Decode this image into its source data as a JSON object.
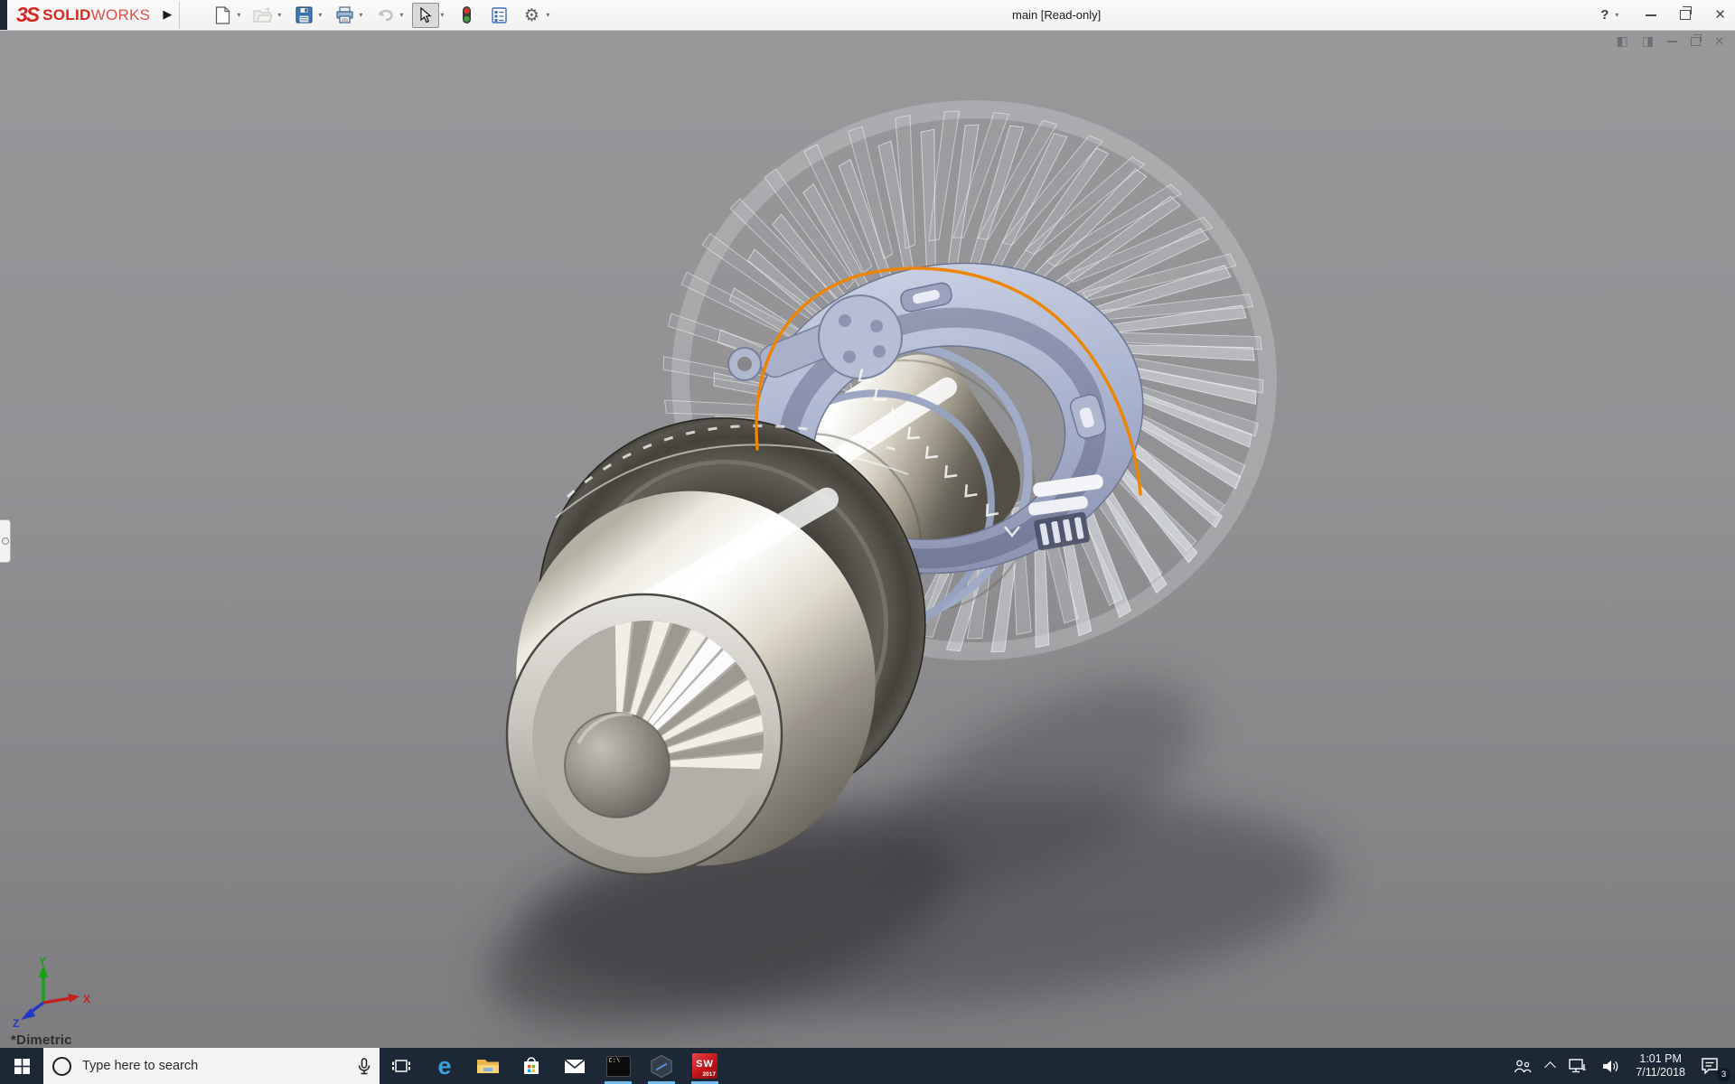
{
  "titlebar": {
    "brand": {
      "mark": "3S",
      "bold": "SOLID",
      "light": "WORKS"
    },
    "title": "main [Read-only]",
    "glyphs": {
      "flyout": "▶",
      "caret": "▾",
      "help": "?",
      "close": "✕"
    },
    "tools": [
      {
        "name": "new-document",
        "enabled": true
      },
      {
        "name": "open",
        "enabled": false
      },
      {
        "name": "save",
        "enabled": true
      },
      {
        "name": "print",
        "enabled": true
      },
      {
        "name": "undo",
        "enabled": false
      },
      {
        "name": "select",
        "enabled": true,
        "active": true
      },
      {
        "name": "rebuild",
        "enabled": true
      },
      {
        "name": "file-properties",
        "enabled": true
      },
      {
        "name": "options",
        "enabled": true
      }
    ]
  },
  "viewport": {
    "view_orientation_label": "*Dimetric",
    "triad": {
      "x_label": "X",
      "y_label": "Y",
      "z_label": "Z",
      "x_color": "#c42020",
      "y_color": "#18a018",
      "z_color": "#2438c8"
    },
    "selection_highlight_color": "#ee8500",
    "doc_controls_glyphs": {
      "pane_left": "◧",
      "pane_right": "◨",
      "close": "✕"
    },
    "background_top": "#98989b",
    "background_bottom": "#7d7d80"
  },
  "taskbar": {
    "search": {
      "placeholder": "Type here to search"
    },
    "app_glyphs": {
      "edge": "e",
      "command_prompt": "C:\\",
      "options_gear": "⚙"
    },
    "solidworks_icon": {
      "line1": "SW",
      "line2": "2017"
    },
    "apps": [
      {
        "name": "task-view",
        "running": false
      },
      {
        "name": "edge",
        "running": false
      },
      {
        "name": "file-explorer",
        "running": false
      },
      {
        "name": "store",
        "running": false
      },
      {
        "name": "mail",
        "running": false
      },
      {
        "name": "command-prompt",
        "running": true
      },
      {
        "name": "hexagon-app",
        "running": true
      },
      {
        "name": "solidworks-2017",
        "running": true
      }
    ],
    "tray": {
      "time": "1:01 PM",
      "date": "7/11/2018",
      "notification_count": "3"
    }
  }
}
